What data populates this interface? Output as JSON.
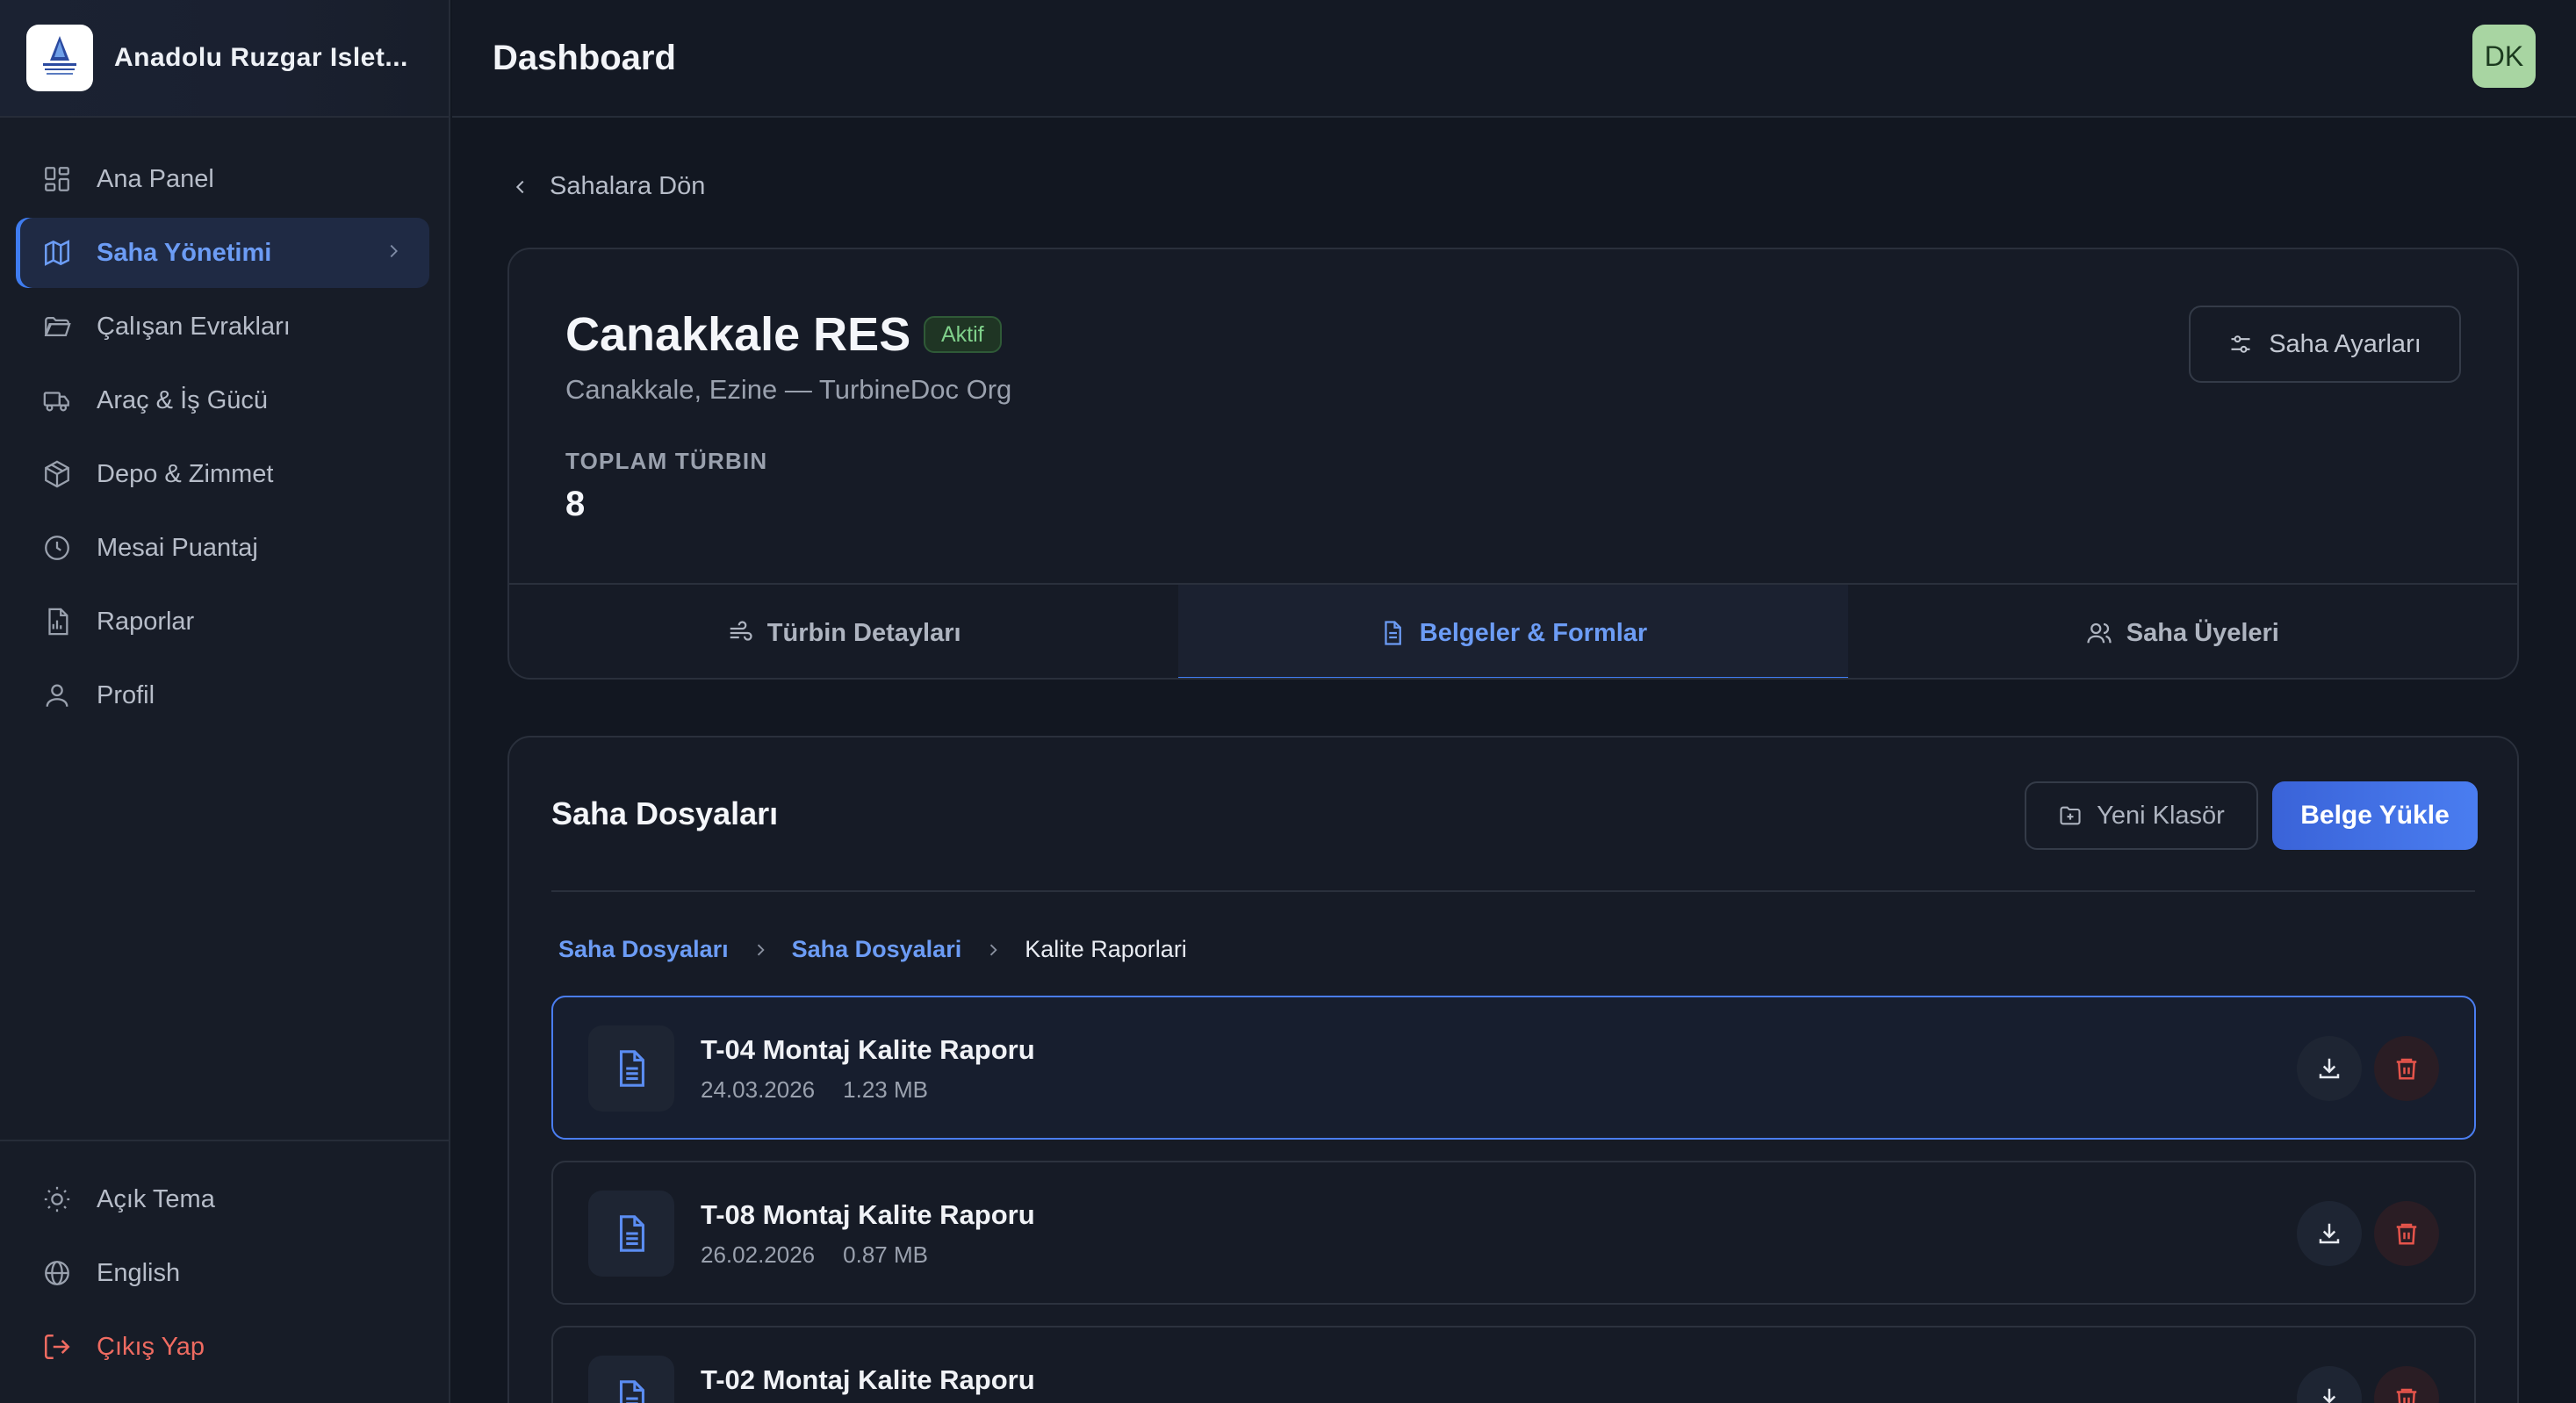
{
  "brand": {
    "name": "Anadolu Ruzgar Islet...",
    "logo_text": "ANADOLU RÜZGAR"
  },
  "sidebar": {
    "items": [
      {
        "label": "Ana Panel",
        "icon": "dashboard-grid-icon"
      },
      {
        "label": "Saha Yönetimi",
        "icon": "map-icon",
        "active": true
      },
      {
        "label": "Çalışan Evrakları",
        "icon": "folder-open-icon"
      },
      {
        "label": "Araç & İş Gücü",
        "icon": "truck-icon"
      },
      {
        "label": "Depo & Zimmet",
        "icon": "package-icon"
      },
      {
        "label": "Mesai Puantaj",
        "icon": "clock-icon"
      },
      {
        "label": "Raporlar",
        "icon": "report-icon"
      },
      {
        "label": "Profil",
        "icon": "user-icon"
      }
    ],
    "bottom": [
      {
        "label": "Açık Tema",
        "icon": "sun-icon"
      },
      {
        "label": "English",
        "icon": "globe-icon"
      },
      {
        "label": "Çıkış Yap",
        "icon": "logout-icon"
      }
    ]
  },
  "header": {
    "title": "Dashboard",
    "avatar_initials": "DK"
  },
  "back_link": "Sahalara Dön",
  "site": {
    "name": "Canakkale RES",
    "status": "Aktif",
    "subtitle": "Canakkale, Ezine — TurbineDoc Org",
    "metric_label": "TOPLAM TÜRBIN",
    "metric_value": "8",
    "settings_label": "Saha Ayarları"
  },
  "tabs": [
    {
      "label": "Türbin Detayları",
      "icon": "wind-icon"
    },
    {
      "label": "Belgeler & Formlar",
      "icon": "document-icon",
      "active": true
    },
    {
      "label": "Saha Üyeleri",
      "icon": "users-icon"
    }
  ],
  "files": {
    "title": "Saha Dosyaları",
    "new_folder_label": "Yeni Klasör",
    "upload_label": "Belge Yükle",
    "breadcrumb": [
      "Saha Dosyaları",
      "Saha Dosyalari",
      "Kalite Raporlari"
    ],
    "items": [
      {
        "name": "T-04 Montaj Kalite Raporu",
        "date": "24.03.2026",
        "size": "1.23 MB",
        "selected": true
      },
      {
        "name": "T-08 Montaj Kalite Raporu",
        "date": "26.02.2026",
        "size": "0.87 MB"
      },
      {
        "name": "T-02 Montaj Kalite Raporu",
        "date": "",
        "size": ""
      }
    ]
  },
  "colors": {
    "accent": "#3f7cf0",
    "accent_text": "#6c9cf5",
    "danger": "#e5544b",
    "success": "#7fd08a",
    "background": "#121721"
  }
}
